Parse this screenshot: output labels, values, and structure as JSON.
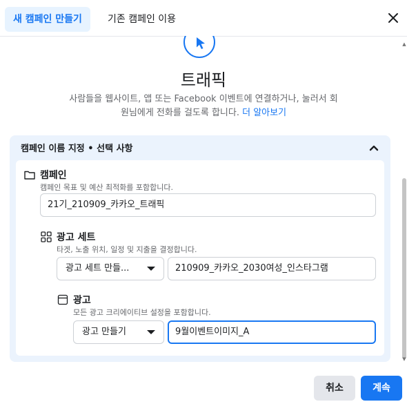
{
  "header": {
    "tab_new": "새 캠페인 만들기",
    "tab_existing": "기존 캠페인 이용",
    "close_icon": "close-icon"
  },
  "objective": {
    "icon": "cursor-icon",
    "title": "트래픽",
    "description_line1": "사람들을 웹사이트, 앱 또는 Facebook 이벤트에 연결하거나, 눌러서 회",
    "description_line2": "원님에게 전화를 걸도록 합니다.",
    "learn_more": "더 알아보기"
  },
  "naming": {
    "title": "캠페인 이름 지정 • 선택 사항",
    "campaign": {
      "icon": "folder-icon",
      "title": "캠페인",
      "description": "캠페인 목표 및 예산 최적화를 포함합니다.",
      "value": "21기_210909_카카오_트래픽"
    },
    "adset": {
      "icon": "grid-icon",
      "title": "광고 세트",
      "description": "타겟, 노출 위치, 일정 및 지출을 결정합니다.",
      "select_value": "광고 세트 만들...",
      "value": "210909_카카오_2030여성_인스타그램"
    },
    "ad": {
      "icon": "ad-icon",
      "title": "광고",
      "description": "모든 광고 크리에이티브 설정을 포함합니다.",
      "select_value": "광고 만들기",
      "value": "9월이벤트이미지_A"
    }
  },
  "footer": {
    "cancel": "취소",
    "continue": "계속"
  },
  "colors": {
    "accent": "#1877f2",
    "panel_bg": "#ebf3fd",
    "tab_active_bg": "#e7f3ff"
  }
}
